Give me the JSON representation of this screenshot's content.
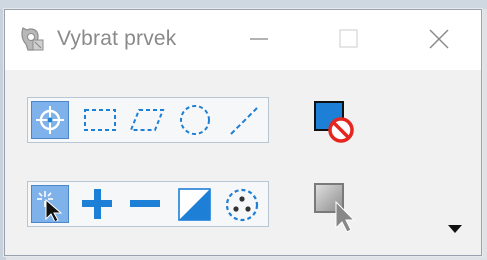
{
  "window": {
    "title": "Vybrat prvek",
    "app_icon": "selection-tool-icon",
    "controls": [
      "minimize-icon",
      "maximize-icon",
      "close-icon"
    ]
  },
  "selection_methods": {
    "tools": [
      "crosshair-select-icon",
      "rectangle-select-icon",
      "parallelogram-select-icon",
      "circle-select-icon",
      "line-select-icon"
    ],
    "active": "crosshair-select-icon"
  },
  "selection_modes": {
    "tools": [
      "new-selection-icon",
      "add-selection-icon",
      "subtract-selection-icon",
      "invert-selection-icon",
      "select-all-icon"
    ],
    "active": "new-selection-icon"
  },
  "side_buttons": [
    "clear-selection-icon",
    "selection-mode-icon"
  ],
  "dropdown": "dropdown-arrow-icon",
  "colors": {
    "accent_blue": "#1e7fd6",
    "active_tool_bg": "#7fb2ea",
    "no_symbol_red": "#e5261f",
    "title_gray": "#8a8a8a"
  }
}
